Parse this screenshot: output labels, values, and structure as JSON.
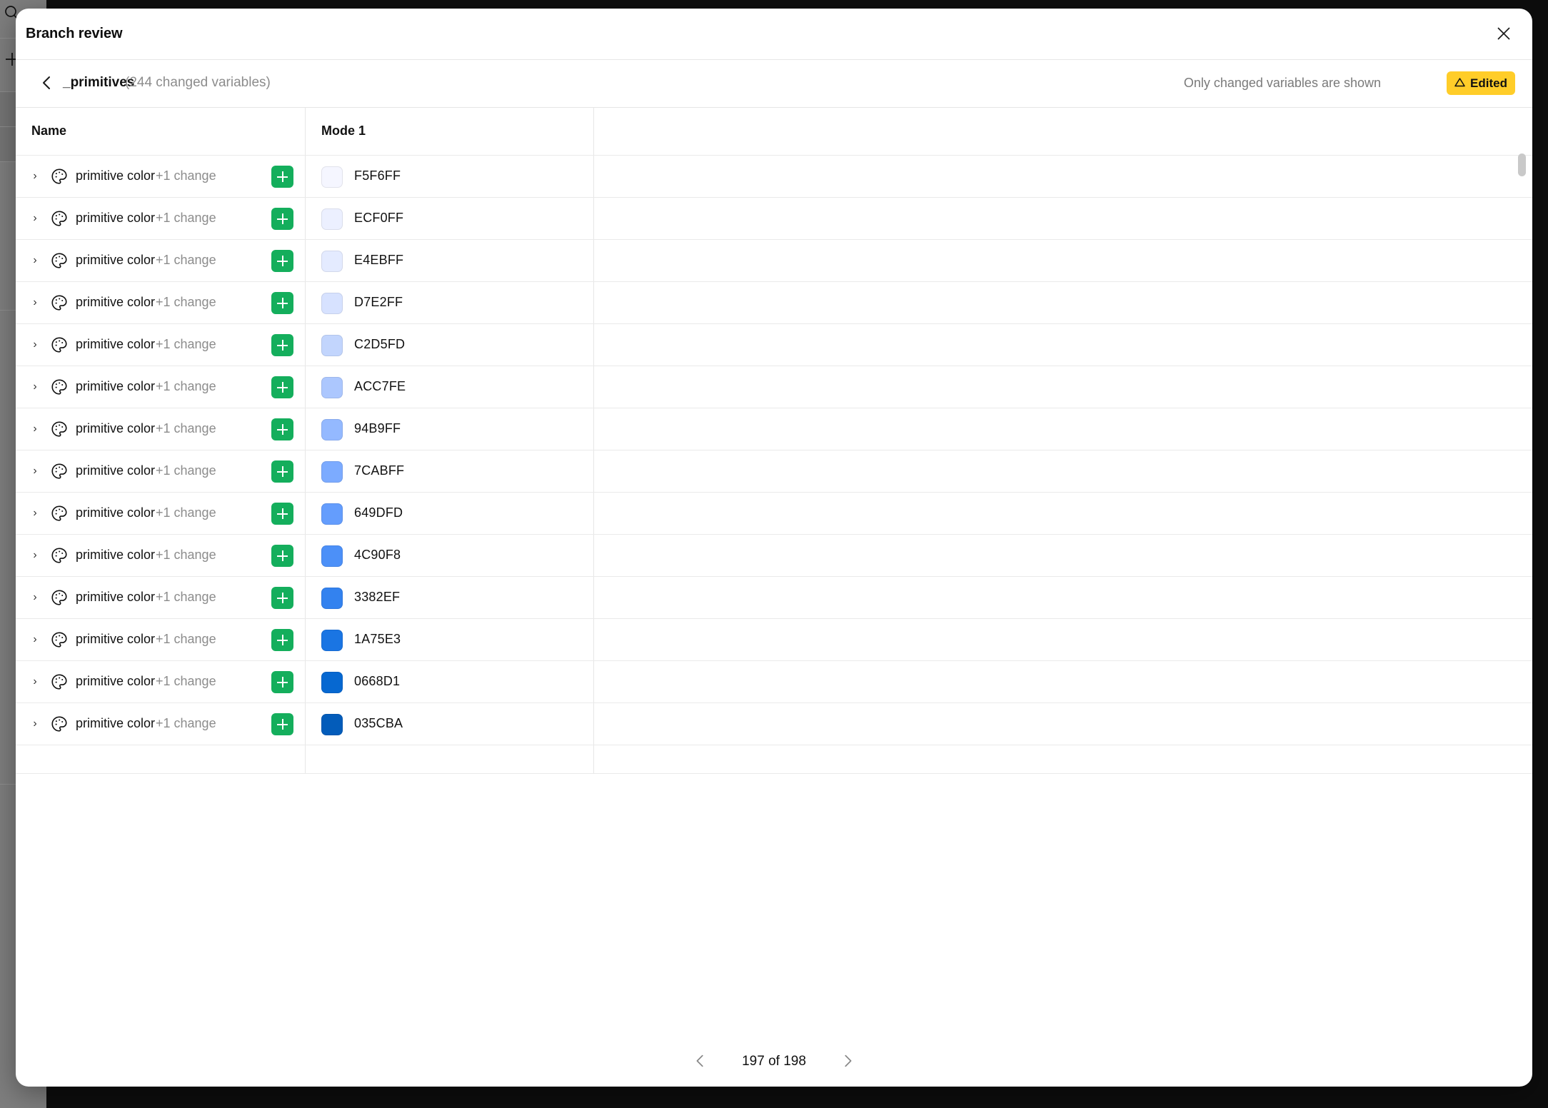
{
  "window": {
    "background_color": "#0d0d0d",
    "left_panel_color": "#7e7e7e",
    "icons": {
      "search": "search-icon",
      "plus": "plus-icon"
    }
  },
  "modal": {
    "title": "Branch review",
    "close_label": "×"
  },
  "subheader": {
    "back_label": "‹",
    "collection_name": "_primitives",
    "changed_variables_label": "(244 changed variables)",
    "filter_note": "Only changed variables are shown",
    "edited_badge": {
      "label": "Edited",
      "icon": "warning-triangle-icon",
      "color": "#FFCD29"
    }
  },
  "table": {
    "columns": [
      "Name",
      "Mode 1",
      ""
    ],
    "added_badge_symbol": "+",
    "row_icon": "palette-icon",
    "disclosure_symbol": "›",
    "rows": [
      {
        "name": "primitive color s",
        "change_label": "+1 change",
        "status": "added",
        "mode1_hex": "F5F6FF",
        "mode1_color": "#F5F6FF"
      },
      {
        "name": "primitive color s",
        "change_label": "+1 change",
        "status": "added",
        "mode1_hex": "ECF0FF",
        "mode1_color": "#ECF0FF"
      },
      {
        "name": "primitive color s",
        "change_label": "+1 change",
        "status": "added",
        "mode1_hex": "E4EBFF",
        "mode1_color": "#E4EBFF"
      },
      {
        "name": "primitive color s",
        "change_label": "+1 change",
        "status": "added",
        "mode1_hex": "D7E2FF",
        "mode1_color": "#D7E2FF"
      },
      {
        "name": "primitive color s",
        "change_label": "+1 change",
        "status": "added",
        "mode1_hex": "C2D5FD",
        "mode1_color": "#C2D5FD"
      },
      {
        "name": "primitive color s",
        "change_label": "+1 change",
        "status": "added",
        "mode1_hex": "ACC7FE",
        "mode1_color": "#ACC7FE"
      },
      {
        "name": "primitive color s",
        "change_label": "+1 change",
        "status": "added",
        "mode1_hex": "94B9FF",
        "mode1_color": "#94B9FF"
      },
      {
        "name": "primitive color s",
        "change_label": "+1 change",
        "status": "added",
        "mode1_hex": "7CABFF",
        "mode1_color": "#7CABFF"
      },
      {
        "name": "primitive color s",
        "change_label": "+1 change",
        "status": "added",
        "mode1_hex": "649DFD",
        "mode1_color": "#649DFD"
      },
      {
        "name": "primitive color s",
        "change_label": "+1 change",
        "status": "added",
        "mode1_hex": "4C90F8",
        "mode1_color": "#4C90F8"
      },
      {
        "name": "primitive color s",
        "change_label": "+1 change",
        "status": "added",
        "mode1_hex": "3382EF",
        "mode1_color": "#3382EF"
      },
      {
        "name": "primitive color s",
        "change_label": "+1 change",
        "status": "added",
        "mode1_hex": "1A75E3",
        "mode1_color": "#1A75E3"
      },
      {
        "name": "primitive color s",
        "change_label": "+1 change",
        "status": "added",
        "mode1_hex": "0668D1",
        "mode1_color": "#0668D1"
      },
      {
        "name": "primitive color s",
        "change_label": "+1 change",
        "status": "added",
        "mode1_hex": "035CBA",
        "mode1_color": "#035CBA"
      }
    ]
  },
  "pagination": {
    "prev_label": "‹",
    "next_label": "›",
    "indicator": "197 of 198",
    "current": 197,
    "total": 198
  }
}
